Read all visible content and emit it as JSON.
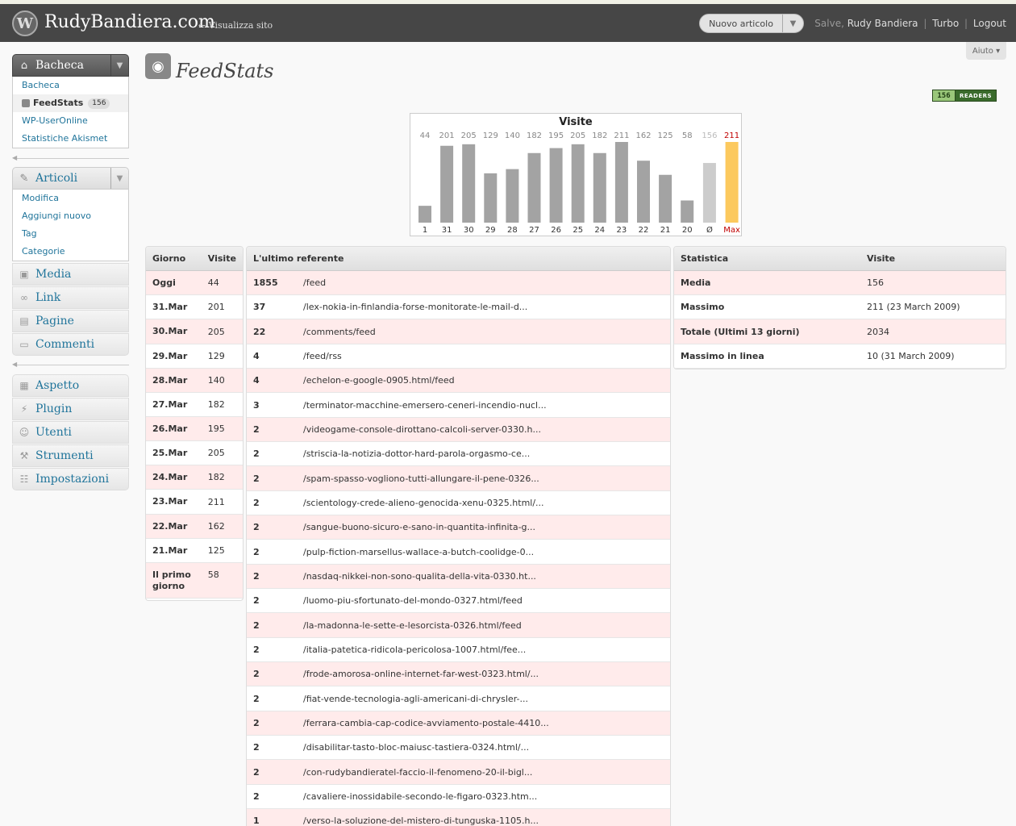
{
  "header": {
    "site_title": "RudyBandiera.com",
    "view_site": "← Visualizza sito",
    "new_post": "Nuovo articolo",
    "greeting": "Salve,",
    "user_name": "Rudy Bandiera",
    "turbo": "Turbo",
    "logout": "Logout",
    "help": "Aiuto ▾"
  },
  "menu": {
    "dashboard": {
      "label": "Bacheca",
      "items": [
        {
          "label": "Bacheca"
        },
        {
          "label": "FeedStats",
          "badge": "156"
        },
        {
          "label": "WP-UserOnline"
        },
        {
          "label": "Statistiche Akismet"
        }
      ]
    },
    "posts": {
      "label": "Articoli",
      "items": [
        {
          "label": "Modifica"
        },
        {
          "label": "Aggiungi nuovo"
        },
        {
          "label": "Tag"
        },
        {
          "label": "Categorie"
        }
      ]
    },
    "media": "Media",
    "links": "Link",
    "pages": "Pagine",
    "comments": "Commenti",
    "appearance": "Aspetto",
    "plugins": "Plugin",
    "users": "Utenti",
    "tools": "Strumenti",
    "settings": "Impostazioni"
  },
  "page": {
    "title": "FeedStats",
    "readers_count": "156",
    "readers_label": "READERS"
  },
  "chart_data": {
    "type": "bar",
    "title": "Visite",
    "categories": [
      "1",
      "31",
      "30",
      "29",
      "28",
      "27",
      "26",
      "25",
      "24",
      "23",
      "22",
      "21",
      "20",
      "Ø",
      "Max"
    ],
    "values": [
      44,
      201,
      205,
      129,
      140,
      182,
      195,
      205,
      182,
      211,
      162,
      125,
      58,
      156,
      211
    ],
    "value_labels": [
      "44",
      "201",
      "205",
      "129",
      "140",
      "182",
      "195",
      "205",
      "182",
      "211",
      "162",
      "125",
      "58",
      "156",
      "211"
    ],
    "ylim": [
      0,
      211
    ],
    "colors": {
      "bar": "#a3a3a3",
      "average": "#cccccc",
      "max": "#fcc95e",
      "max_label": "#c00000",
      "avg_label": "#bbbbbb"
    }
  },
  "days_table": {
    "headers": [
      "Giorno",
      "Visite"
    ],
    "rows": [
      {
        "day": "Oggi",
        "visits": "44"
      },
      {
        "day": "31.Mar",
        "visits": "201"
      },
      {
        "day": "30.Mar",
        "visits": "205"
      },
      {
        "day": "29.Mar",
        "visits": "129"
      },
      {
        "day": "28.Mar",
        "visits": "140"
      },
      {
        "day": "27.Mar",
        "visits": "182"
      },
      {
        "day": "26.Mar",
        "visits": "195"
      },
      {
        "day": "25.Mar",
        "visits": "205"
      },
      {
        "day": "24.Mar",
        "visits": "182"
      },
      {
        "day": "23.Mar",
        "visits": "211"
      },
      {
        "day": "22.Mar",
        "visits": "162"
      },
      {
        "day": "21.Mar",
        "visits": "125"
      },
      {
        "day": "Il primo giorno",
        "visits": "58"
      }
    ]
  },
  "referrer_table": {
    "header": "L'ultimo referente",
    "rows": [
      {
        "count": "1855",
        "path": "/feed"
      },
      {
        "count": "37",
        "path": "/lex-nokia-in-finlandia-forse-monitorate-le-mail-d..."
      },
      {
        "count": "22",
        "path": "/comments/feed"
      },
      {
        "count": "4",
        "path": "/feed/rss"
      },
      {
        "count": "4",
        "path": "/echelon-e-google-0905.html/feed"
      },
      {
        "count": "3",
        "path": "/terminator-macchine-emersero-ceneri-incendio-nucl..."
      },
      {
        "count": "2",
        "path": "/videogame-console-dirottano-calcoli-server-0330.h..."
      },
      {
        "count": "2",
        "path": "/striscia-la-notizia-dottor-hard-parola-orgasmo-ce..."
      },
      {
        "count": "2",
        "path": "/spam-spasso-vogliono-tutti-allungare-il-pene-0326..."
      },
      {
        "count": "2",
        "path": "/scientology-crede-alieno-genocida-xenu-0325.html/..."
      },
      {
        "count": "2",
        "path": "/sangue-buono-sicuro-e-sano-in-quantita-infinita-g..."
      },
      {
        "count": "2",
        "path": "/pulp-fiction-marsellus-wallace-a-butch-coolidge-0..."
      },
      {
        "count": "2",
        "path": "/nasdaq-nikkei-non-sono-qualita-della-vita-0330.ht..."
      },
      {
        "count": "2",
        "path": "/luomo-piu-sfortunato-del-mondo-0327.html/feed"
      },
      {
        "count": "2",
        "path": "/la-madonna-le-sette-e-lesorcista-0326.html/feed"
      },
      {
        "count": "2",
        "path": "/italia-patetica-ridicola-pericolosa-1007.html/fee..."
      },
      {
        "count": "2",
        "path": "/frode-amorosa-online-internet-far-west-0323.html/..."
      },
      {
        "count": "2",
        "path": "/fiat-vende-tecnologia-agli-americani-di-chrysler-..."
      },
      {
        "count": "2",
        "path": "/ferrara-cambia-cap-codice-avviamento-postale-4410..."
      },
      {
        "count": "2",
        "path": "/disabilitar-tasto-bloc-maiusc-tastiera-0324.html/..."
      },
      {
        "count": "2",
        "path": "/con-rudybandieratel-faccio-il-fenomeno-20-il-bigl..."
      },
      {
        "count": "2",
        "path": "/cavaliere-inossidabile-secondo-le-figaro-0323.htm..."
      },
      {
        "count": "1",
        "path": "/verso-la-soluzione-del-mistero-di-tunguska-1105.h..."
      }
    ]
  },
  "stats_table": {
    "headers": [
      "Statistica",
      "Visite"
    ],
    "rows": [
      {
        "label": "Media",
        "value": "156"
      },
      {
        "label": "Massimo",
        "value": "211 (23 March 2009)"
      },
      {
        "label": "Totale (Ultimi 13 giorni)",
        "value": "2034"
      },
      {
        "label": "Massimo in linea",
        "value": "10 (31 March 2009)"
      }
    ]
  }
}
